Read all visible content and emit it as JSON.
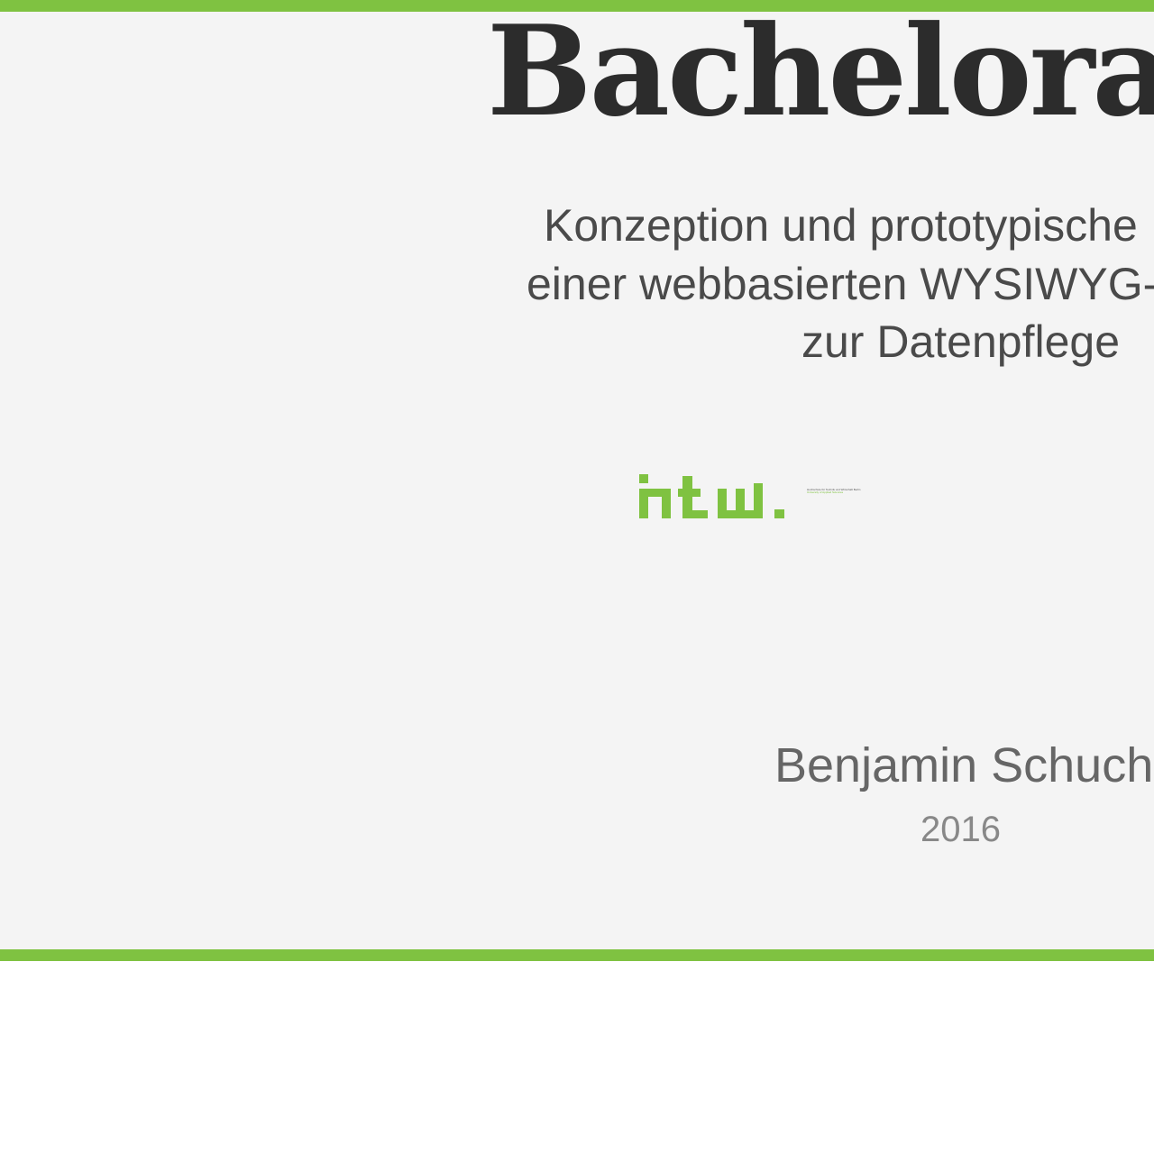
{
  "slide": {
    "title": "Bachelorar",
    "subtitle_lines": [
      "Konzeption und prototypische",
      "einer webbasierten WYSIWYG-",
      "zur Datenpflege"
    ],
    "logo": {
      "wordmark": "htw.",
      "tagline_de": "Hochschule für Technik und Wirtschaft Berlin",
      "tagline_en": "University of Applied Sciences",
      "icon": "htw-logo-icon"
    },
    "author": "Benjamin Schuch",
    "year": "2016"
  },
  "colors": {
    "accent": "#7fc241",
    "background": "#f4f4f4",
    "title": "#2c2c2c",
    "subtitle": "#4a4a4a",
    "author": "#666666",
    "year": "#888888"
  }
}
